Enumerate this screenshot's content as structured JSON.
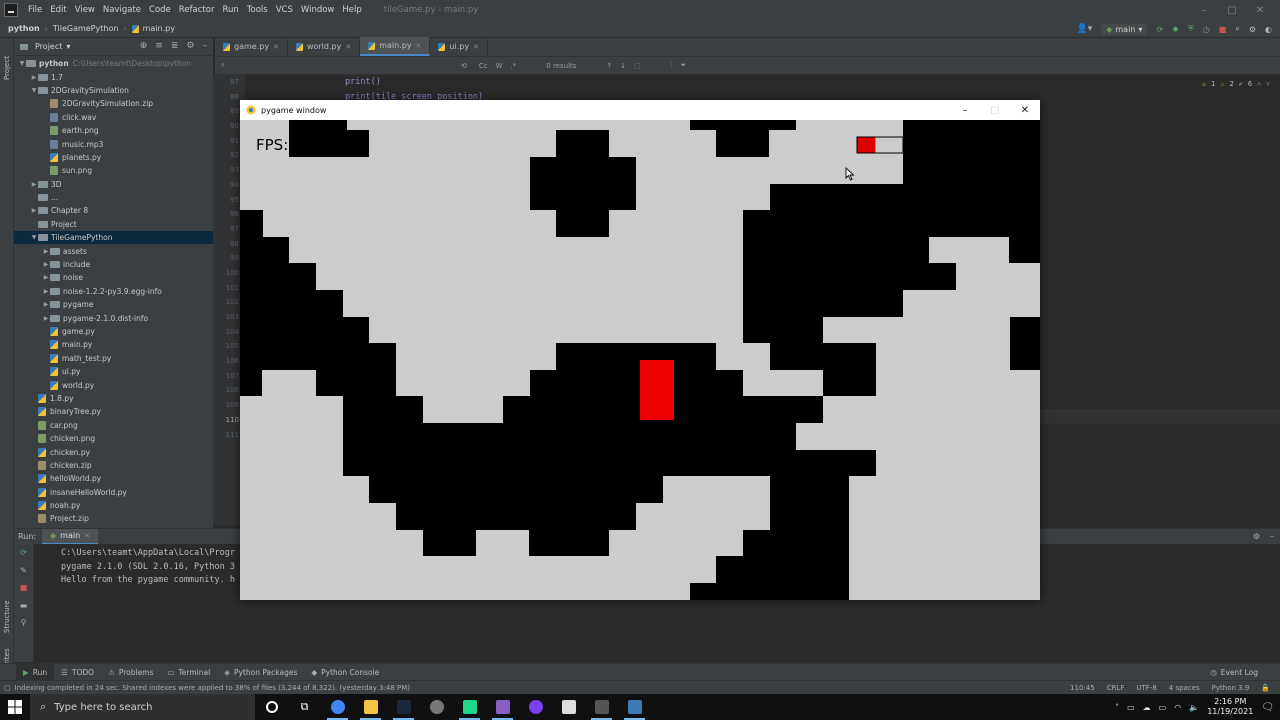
{
  "menubar": {
    "items": [
      "File",
      "Edit",
      "View",
      "Navigate",
      "Code",
      "Refactor",
      "Run",
      "Tools",
      "VCS",
      "Window",
      "Help"
    ],
    "window_title": "tileGame.py - main.py"
  },
  "navbar": {
    "crumbs": [
      "python",
      "TileGamePython",
      "main.py"
    ],
    "branch": "main",
    "accent_color": "#4a88c7"
  },
  "project": {
    "title": "Project",
    "tree": [
      {
        "label": "python",
        "extra": "C:\\Users\\teamt\\Desktop\\python",
        "depth": 0,
        "arrow": "down",
        "kind": "folder"
      },
      {
        "label": "1.7",
        "depth": 1,
        "arrow": "right",
        "kind": "folder"
      },
      {
        "label": "2DGravitySimulation",
        "depth": 1,
        "arrow": "down",
        "kind": "folder"
      },
      {
        "label": "2DGravitySimulation.zip",
        "depth": 2,
        "kind": "zip"
      },
      {
        "label": "click.wav",
        "depth": 2,
        "kind": "snd"
      },
      {
        "label": "earth.png",
        "depth": 2,
        "kind": "img"
      },
      {
        "label": "music.mp3",
        "depth": 2,
        "kind": "snd"
      },
      {
        "label": "planets.py",
        "depth": 2,
        "kind": "py"
      },
      {
        "label": "sun.png",
        "depth": 2,
        "kind": "img"
      },
      {
        "label": "3D",
        "depth": 1,
        "arrow": "right",
        "kind": "folder"
      },
      {
        "label": "...",
        "depth": 1,
        "kind": "folder"
      },
      {
        "label": "Chapter 8",
        "depth": 1,
        "arrow": "right",
        "kind": "folder"
      },
      {
        "label": "Project",
        "depth": 1,
        "kind": "folder"
      },
      {
        "label": "TileGamePython",
        "depth": 1,
        "arrow": "down",
        "kind": "folder",
        "selected": true
      },
      {
        "label": "assets",
        "depth": 2,
        "arrow": "right",
        "kind": "folder"
      },
      {
        "label": "include",
        "depth": 2,
        "arrow": "right",
        "kind": "folder"
      },
      {
        "label": "noise",
        "depth": 2,
        "arrow": "right",
        "kind": "folder"
      },
      {
        "label": "noise-1.2.2-py3.9.egg-info",
        "depth": 2,
        "arrow": "right",
        "kind": "folder"
      },
      {
        "label": "pygame",
        "depth": 2,
        "arrow": "right",
        "kind": "folder"
      },
      {
        "label": "pygame-2.1.0.dist-info",
        "depth": 2,
        "arrow": "right",
        "kind": "folder"
      },
      {
        "label": "game.py",
        "depth": 2,
        "kind": "py"
      },
      {
        "label": "main.py",
        "depth": 2,
        "kind": "py"
      },
      {
        "label": "math_test.py",
        "depth": 2,
        "kind": "py"
      },
      {
        "label": "ui.py",
        "depth": 2,
        "kind": "py"
      },
      {
        "label": "world.py",
        "depth": 2,
        "kind": "py"
      },
      {
        "label": "1.8.py",
        "depth": 1,
        "kind": "py"
      },
      {
        "label": "binaryTree.py",
        "depth": 1,
        "kind": "py"
      },
      {
        "label": "car.png",
        "depth": 1,
        "kind": "img"
      },
      {
        "label": "chicken.png",
        "depth": 1,
        "kind": "img"
      },
      {
        "label": "chicken.py",
        "depth": 1,
        "kind": "py"
      },
      {
        "label": "chicken.zip",
        "depth": 1,
        "kind": "zip"
      },
      {
        "label": "helloWorld.py",
        "depth": 1,
        "kind": "py"
      },
      {
        "label": "insaneHelloWorld.py",
        "depth": 1,
        "kind": "py"
      },
      {
        "label": "noah.py",
        "depth": 1,
        "kind": "py"
      },
      {
        "label": "Project.zip",
        "depth": 1,
        "kind": "zip"
      }
    ]
  },
  "editor": {
    "tabs": [
      {
        "label": "game.py",
        "active": false
      },
      {
        "label": "world.py",
        "active": false
      },
      {
        "label": "main.py",
        "active": true
      },
      {
        "label": "ui.py",
        "active": false
      }
    ],
    "find": {
      "results": "0 results",
      "case_label": "Cc",
      "word_label": "W",
      "regex_label": ".*"
    },
    "line_numbers": [
      "87",
      "88",
      "89",
      "90",
      "91",
      "92",
      "93",
      "94",
      "95",
      "96",
      "97",
      "98",
      "99",
      "100",
      "101",
      "102",
      "103",
      "104",
      "105",
      "106",
      "107",
      "108",
      "109",
      "110",
      "111"
    ],
    "current_line": "110",
    "code_lines": [
      "print()",
      "print(tile_screen_position)"
    ],
    "inspections": {
      "warnings": "1",
      "weak_warnings": "2",
      "typos": "6"
    }
  },
  "run": {
    "label": "Run:",
    "tab": "main",
    "console": [
      "C:\\Users\\teamt\\AppData\\Local\\Progr",
      "pygame 2.1.0 (SDL 2.0.16, Python 3",
      "Hello from the pygame community. h"
    ]
  },
  "bottom_tabs": [
    "Run",
    "TODO",
    "Problems",
    "Terminal",
    "Python Packages",
    "Python Console"
  ],
  "event_log": "Event Log",
  "status": {
    "message": "Indexing completed in 24 sec. Shared indexes were applied to 38% of files (3,244 of 8,322). (yesterday 3:48 PM)",
    "position": "110:45",
    "line_sep": "CRLF",
    "encoding": "UTF-8",
    "indent": "4 spaces",
    "interpreter": "Python 3.9"
  },
  "taskbar": {
    "search_placeholder": "Type here to search",
    "time": "2:16 PM",
    "date": "11/19/2021",
    "apps": [
      "cortana",
      "task-view",
      "chrome",
      "file-explorer",
      "steam",
      "obs",
      "pycharm",
      "visual-studio",
      "github-desktop",
      "unity",
      "calculator",
      "pygame"
    ]
  },
  "pygame": {
    "title": "pygame window",
    "fps_label": "FPS:",
    "colors": {
      "background": "#cccccc",
      "tile": "#000000",
      "player": "#ee0000",
      "healthbar": "#dd0000"
    },
    "healthbar_fill": 0.4
  },
  "left_strip": {
    "structure": "Structure",
    "favorites": "Favorites",
    "project": "Project"
  }
}
